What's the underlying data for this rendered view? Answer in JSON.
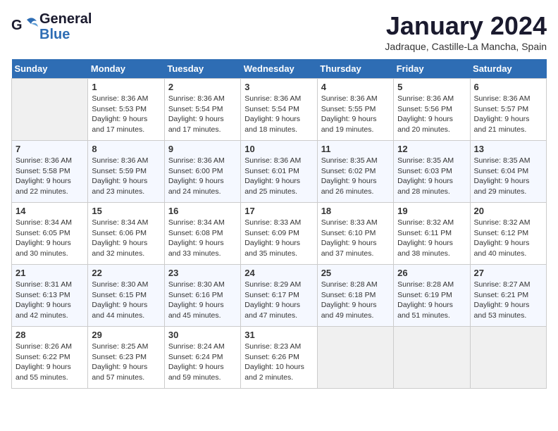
{
  "header": {
    "logo_line1": "General",
    "logo_line2": "Blue",
    "month": "January 2024",
    "location": "Jadraque, Castille-La Mancha, Spain"
  },
  "weekdays": [
    "Sunday",
    "Monday",
    "Tuesday",
    "Wednesday",
    "Thursday",
    "Friday",
    "Saturday"
  ],
  "weeks": [
    [
      {
        "day": "",
        "sunrise": "",
        "sunset": "",
        "daylight": ""
      },
      {
        "day": "1",
        "sunrise": "Sunrise: 8:36 AM",
        "sunset": "Sunset: 5:53 PM",
        "daylight": "Daylight: 9 hours and 17 minutes."
      },
      {
        "day": "2",
        "sunrise": "Sunrise: 8:36 AM",
        "sunset": "Sunset: 5:54 PM",
        "daylight": "Daylight: 9 hours and 17 minutes."
      },
      {
        "day": "3",
        "sunrise": "Sunrise: 8:36 AM",
        "sunset": "Sunset: 5:54 PM",
        "daylight": "Daylight: 9 hours and 18 minutes."
      },
      {
        "day": "4",
        "sunrise": "Sunrise: 8:36 AM",
        "sunset": "Sunset: 5:55 PM",
        "daylight": "Daylight: 9 hours and 19 minutes."
      },
      {
        "day": "5",
        "sunrise": "Sunrise: 8:36 AM",
        "sunset": "Sunset: 5:56 PM",
        "daylight": "Daylight: 9 hours and 20 minutes."
      },
      {
        "day": "6",
        "sunrise": "Sunrise: 8:36 AM",
        "sunset": "Sunset: 5:57 PM",
        "daylight": "Daylight: 9 hours and 21 minutes."
      }
    ],
    [
      {
        "day": "7",
        "sunrise": "Sunrise: 8:36 AM",
        "sunset": "Sunset: 5:58 PM",
        "daylight": "Daylight: 9 hours and 22 minutes."
      },
      {
        "day": "8",
        "sunrise": "Sunrise: 8:36 AM",
        "sunset": "Sunset: 5:59 PM",
        "daylight": "Daylight: 9 hours and 23 minutes."
      },
      {
        "day": "9",
        "sunrise": "Sunrise: 8:36 AM",
        "sunset": "Sunset: 6:00 PM",
        "daylight": "Daylight: 9 hours and 24 minutes."
      },
      {
        "day": "10",
        "sunrise": "Sunrise: 8:36 AM",
        "sunset": "Sunset: 6:01 PM",
        "daylight": "Daylight: 9 hours and 25 minutes."
      },
      {
        "day": "11",
        "sunrise": "Sunrise: 8:35 AM",
        "sunset": "Sunset: 6:02 PM",
        "daylight": "Daylight: 9 hours and 26 minutes."
      },
      {
        "day": "12",
        "sunrise": "Sunrise: 8:35 AM",
        "sunset": "Sunset: 6:03 PM",
        "daylight": "Daylight: 9 hours and 28 minutes."
      },
      {
        "day": "13",
        "sunrise": "Sunrise: 8:35 AM",
        "sunset": "Sunset: 6:04 PM",
        "daylight": "Daylight: 9 hours and 29 minutes."
      }
    ],
    [
      {
        "day": "14",
        "sunrise": "Sunrise: 8:34 AM",
        "sunset": "Sunset: 6:05 PM",
        "daylight": "Daylight: 9 hours and 30 minutes."
      },
      {
        "day": "15",
        "sunrise": "Sunrise: 8:34 AM",
        "sunset": "Sunset: 6:06 PM",
        "daylight": "Daylight: 9 hours and 32 minutes."
      },
      {
        "day": "16",
        "sunrise": "Sunrise: 8:34 AM",
        "sunset": "Sunset: 6:08 PM",
        "daylight": "Daylight: 9 hours and 33 minutes."
      },
      {
        "day": "17",
        "sunrise": "Sunrise: 8:33 AM",
        "sunset": "Sunset: 6:09 PM",
        "daylight": "Daylight: 9 hours and 35 minutes."
      },
      {
        "day": "18",
        "sunrise": "Sunrise: 8:33 AM",
        "sunset": "Sunset: 6:10 PM",
        "daylight": "Daylight: 9 hours and 37 minutes."
      },
      {
        "day": "19",
        "sunrise": "Sunrise: 8:32 AM",
        "sunset": "Sunset: 6:11 PM",
        "daylight": "Daylight: 9 hours and 38 minutes."
      },
      {
        "day": "20",
        "sunrise": "Sunrise: 8:32 AM",
        "sunset": "Sunset: 6:12 PM",
        "daylight": "Daylight: 9 hours and 40 minutes."
      }
    ],
    [
      {
        "day": "21",
        "sunrise": "Sunrise: 8:31 AM",
        "sunset": "Sunset: 6:13 PM",
        "daylight": "Daylight: 9 hours and 42 minutes."
      },
      {
        "day": "22",
        "sunrise": "Sunrise: 8:30 AM",
        "sunset": "Sunset: 6:15 PM",
        "daylight": "Daylight: 9 hours and 44 minutes."
      },
      {
        "day": "23",
        "sunrise": "Sunrise: 8:30 AM",
        "sunset": "Sunset: 6:16 PM",
        "daylight": "Daylight: 9 hours and 45 minutes."
      },
      {
        "day": "24",
        "sunrise": "Sunrise: 8:29 AM",
        "sunset": "Sunset: 6:17 PM",
        "daylight": "Daylight: 9 hours and 47 minutes."
      },
      {
        "day": "25",
        "sunrise": "Sunrise: 8:28 AM",
        "sunset": "Sunset: 6:18 PM",
        "daylight": "Daylight: 9 hours and 49 minutes."
      },
      {
        "day": "26",
        "sunrise": "Sunrise: 8:28 AM",
        "sunset": "Sunset: 6:19 PM",
        "daylight": "Daylight: 9 hours and 51 minutes."
      },
      {
        "day": "27",
        "sunrise": "Sunrise: 8:27 AM",
        "sunset": "Sunset: 6:21 PM",
        "daylight": "Daylight: 9 hours and 53 minutes."
      }
    ],
    [
      {
        "day": "28",
        "sunrise": "Sunrise: 8:26 AM",
        "sunset": "Sunset: 6:22 PM",
        "daylight": "Daylight: 9 hours and 55 minutes."
      },
      {
        "day": "29",
        "sunrise": "Sunrise: 8:25 AM",
        "sunset": "Sunset: 6:23 PM",
        "daylight": "Daylight: 9 hours and 57 minutes."
      },
      {
        "day": "30",
        "sunrise": "Sunrise: 8:24 AM",
        "sunset": "Sunset: 6:24 PM",
        "daylight": "Daylight: 9 hours and 59 minutes."
      },
      {
        "day": "31",
        "sunrise": "Sunrise: 8:23 AM",
        "sunset": "Sunset: 6:26 PM",
        "daylight": "Daylight: 10 hours and 2 minutes."
      },
      {
        "day": "",
        "sunrise": "",
        "sunset": "",
        "daylight": ""
      },
      {
        "day": "",
        "sunrise": "",
        "sunset": "",
        "daylight": ""
      },
      {
        "day": "",
        "sunrise": "",
        "sunset": "",
        "daylight": ""
      }
    ]
  ]
}
